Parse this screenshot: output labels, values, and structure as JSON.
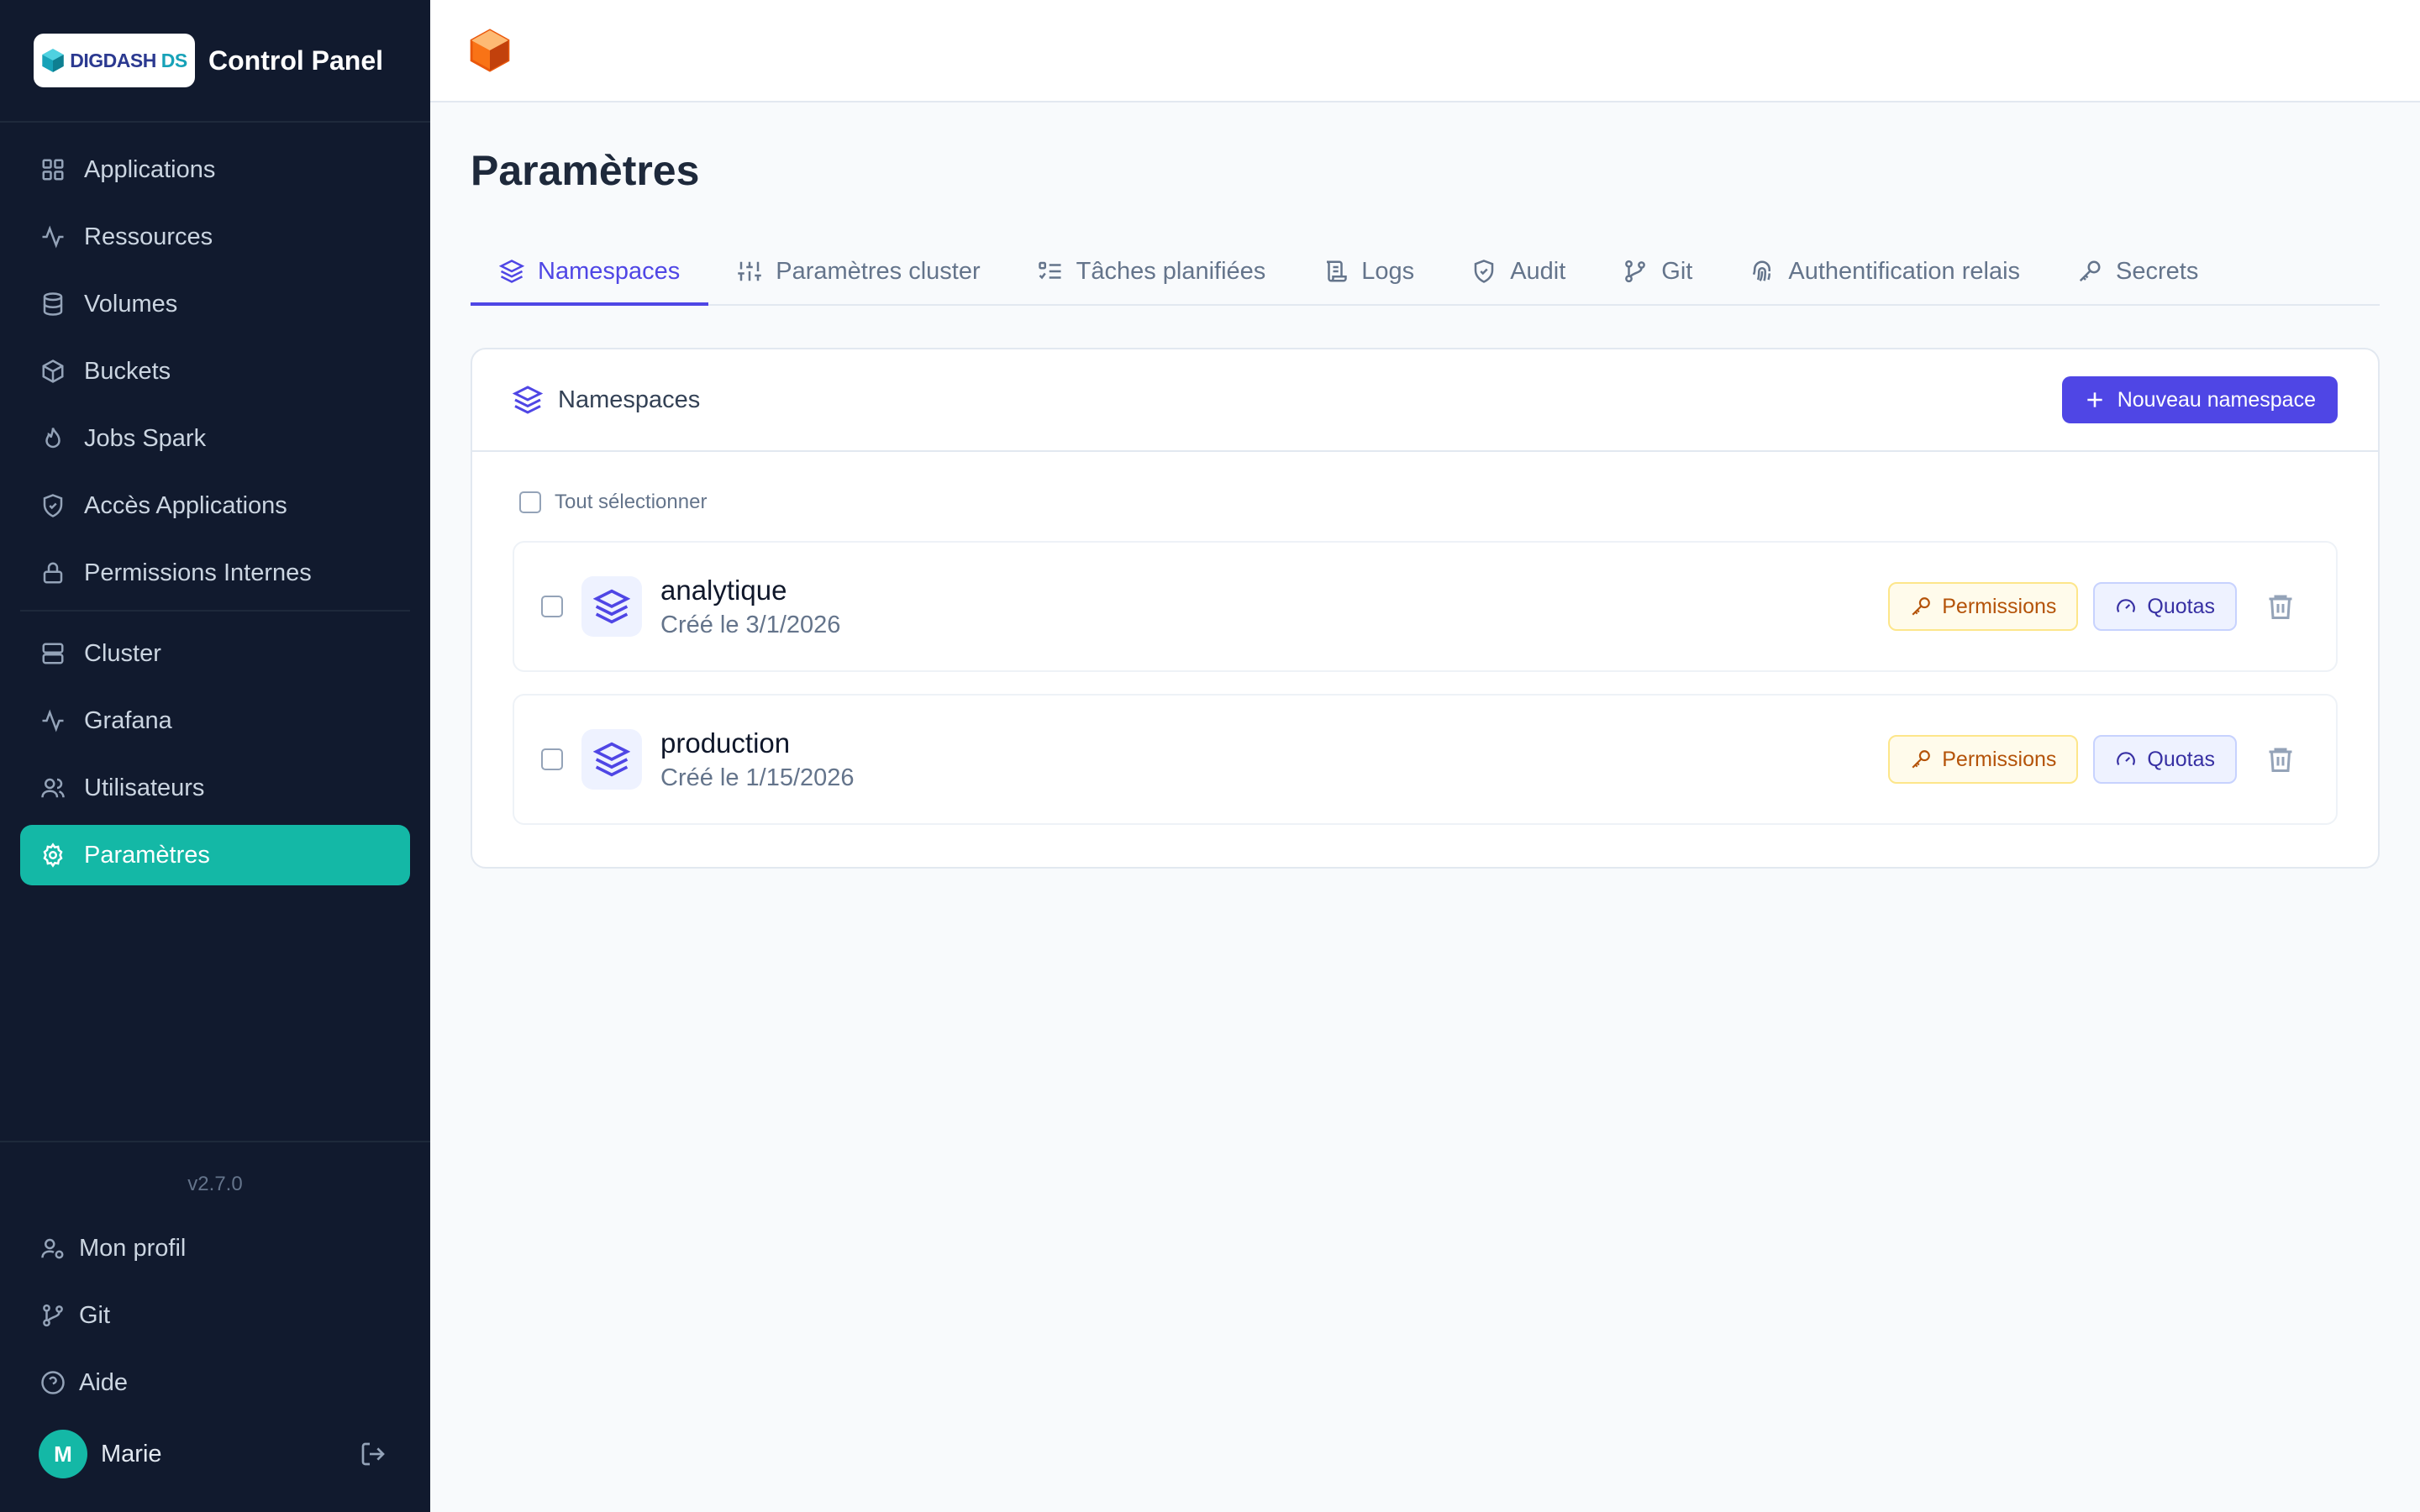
{
  "brand": {
    "logo_text_a": "DIGDASH",
    "logo_text_b": "DS",
    "title": "Control Panel"
  },
  "sidebar": {
    "items": [
      {
        "label": "Applications",
        "icon": "grid-icon"
      },
      {
        "label": "Ressources",
        "icon": "activity-icon"
      },
      {
        "label": "Volumes",
        "icon": "database-icon"
      },
      {
        "label": "Buckets",
        "icon": "box-icon"
      },
      {
        "label": "Jobs Spark",
        "icon": "flame-icon"
      },
      {
        "label": "Accès Applications",
        "icon": "shield-check-icon"
      },
      {
        "label": "Permissions Internes",
        "icon": "lock-icon"
      },
      {
        "label": "Cluster",
        "icon": "server-icon"
      },
      {
        "label": "Grafana",
        "icon": "activity-icon"
      },
      {
        "label": "Utilisateurs",
        "icon": "users-icon"
      },
      {
        "label": "Paramètres",
        "icon": "settings-icon",
        "active": true
      }
    ],
    "version": "v2.7.0",
    "bottom": [
      {
        "label": "Mon profil",
        "icon": "user-cog-icon"
      },
      {
        "label": "Git",
        "icon": "git-branch-icon"
      },
      {
        "label": "Aide",
        "icon": "help-circle-icon"
      }
    ],
    "user": {
      "initial": "M",
      "name": "Marie"
    }
  },
  "page": {
    "title": "Paramètres"
  },
  "tabs": [
    {
      "label": "Namespaces",
      "icon": "layers-icon",
      "active": true
    },
    {
      "label": "Paramètres cluster",
      "icon": "sliders-icon"
    },
    {
      "label": "Tâches planifiées",
      "icon": "list-checks-icon"
    },
    {
      "label": "Logs",
      "icon": "scroll-icon"
    },
    {
      "label": "Audit",
      "icon": "shield-check-icon"
    },
    {
      "label": "Git",
      "icon": "git-branch-icon"
    },
    {
      "label": "Authentification relais",
      "icon": "fingerprint-icon"
    },
    {
      "label": "Secrets",
      "icon": "key-icon"
    }
  ],
  "namespaces_card": {
    "title": "Namespaces",
    "new_button": "Nouveau namespace",
    "select_all": "Tout sélectionner",
    "permissions_label": "Permissions",
    "quotas_label": "Quotas",
    "rows": [
      {
        "name": "analytique",
        "created": "Créé le 3/1/2026"
      },
      {
        "name": "production",
        "created": "Créé le 1/15/2026"
      }
    ]
  },
  "colors": {
    "sidebar_bg": "#111a2e",
    "active_nav": "#14b8a6",
    "accent": "#4f46e5",
    "permissions": "#b45309",
    "logo_orange": "#f97316"
  }
}
